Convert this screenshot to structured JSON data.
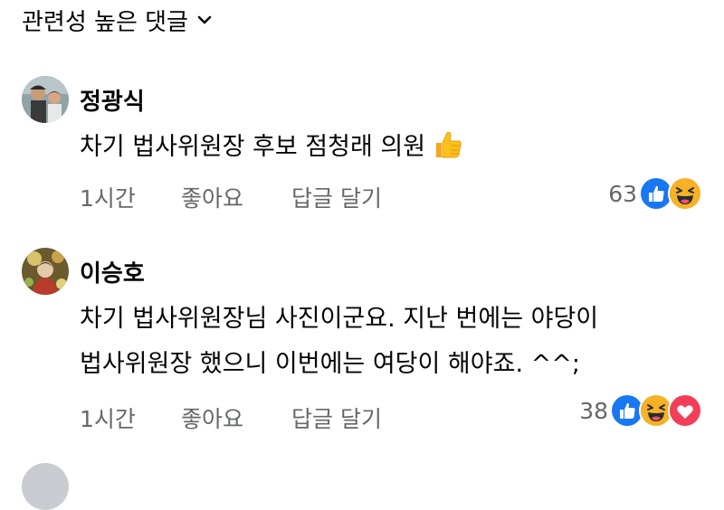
{
  "header": {
    "sort_label": "관련성 높은 댓글"
  },
  "comments": [
    {
      "author": "정광식",
      "text": "차기 법사위원장 후보 점청래 의원",
      "emoji": "thumbs-up-emoji",
      "time": "1시간",
      "like_label": "좋아요",
      "reply_label": "답글 달기",
      "reaction_count": "63",
      "reactions": [
        "like",
        "haha"
      ]
    },
    {
      "author": "이승호",
      "text_lines": [
        "차기 법사위원장님 사진이군요. 지난 번에는 야당이",
        "법사위원장 했으니 이번에는 여당이 해야죠. ^^;"
      ],
      "time": "1시간",
      "like_label": "좋아요",
      "reply_label": "답글 달기",
      "reaction_count": "38",
      "reactions": [
        "like",
        "haha",
        "love"
      ]
    }
  ],
  "colors": {
    "like_blue": "#1877f2",
    "haha_yellow": "#f7b125",
    "love_red": "#f33e58",
    "meta_gray": "#65676b"
  }
}
